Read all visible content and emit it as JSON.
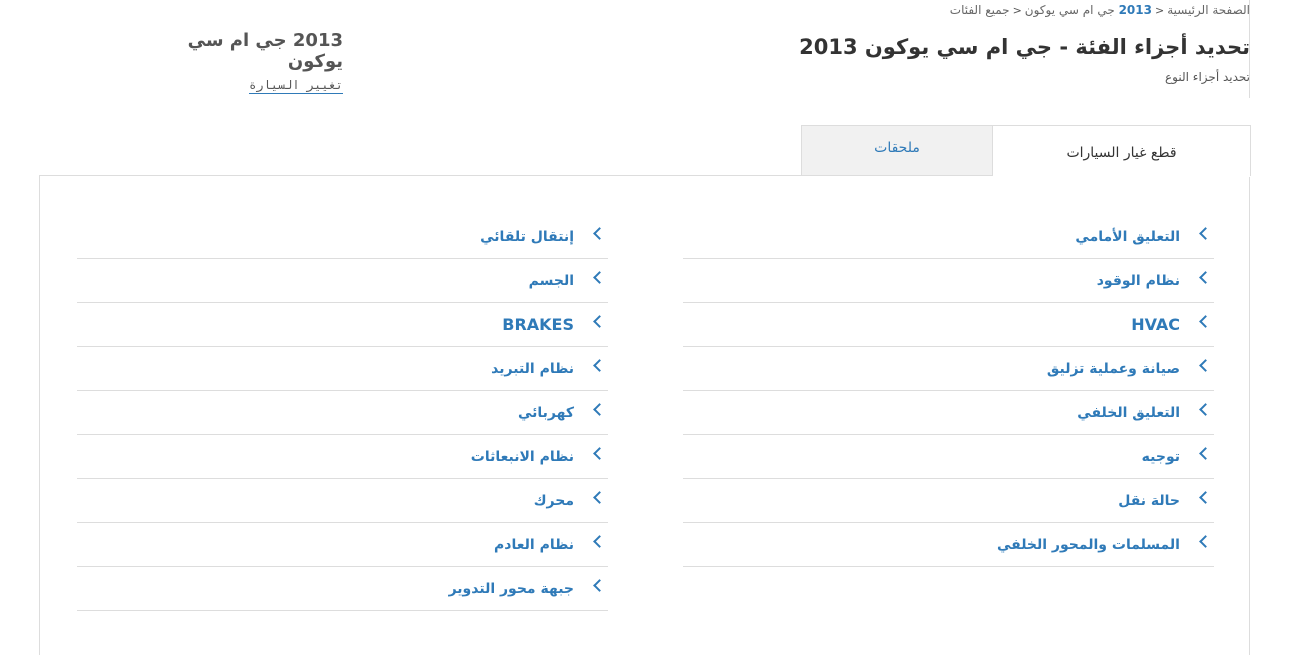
{
  "breadcrumb": {
    "home": "الصفحة الرئيسية",
    "vehicle": "2013",
    "vehicle_name": "جي ام سي يوكون",
    "current": "جميع الفئات"
  },
  "header": {
    "title": "تحديد أجزاء الفئة - جي ام سي يوكون 2013",
    "subtitle": "تحديد أجزاء النوع"
  },
  "vehicle_box": {
    "name": "2013 جي ام سي يوكون",
    "change_label": "تغيير السيارة"
  },
  "tabs": [
    {
      "label": "قطع غيار السيارات",
      "active": true
    },
    {
      "label": "ملحقات",
      "active": false
    }
  ],
  "categories": {
    "right": [
      "التعليق الأمامي",
      "نظام الوقود",
      "HVAC",
      "صيانة وعملية تزليق",
      "التعليق الخلفي",
      "توجيه",
      "حالة نقل",
      "المسلمات والمحور الخلفي"
    ],
    "left": [
      "إنتقال تلقائي",
      "الجسم",
      "BRAKES",
      "نظام التبريد",
      "كهربائي",
      "نظام الانبعاثات",
      "محرك",
      "نظام العادم",
      "جبهة محور التدوير"
    ]
  },
  "colors": {
    "link": "#2f7ab8",
    "border": "#dddddd",
    "inactive_tab": "#f1f1f1"
  }
}
